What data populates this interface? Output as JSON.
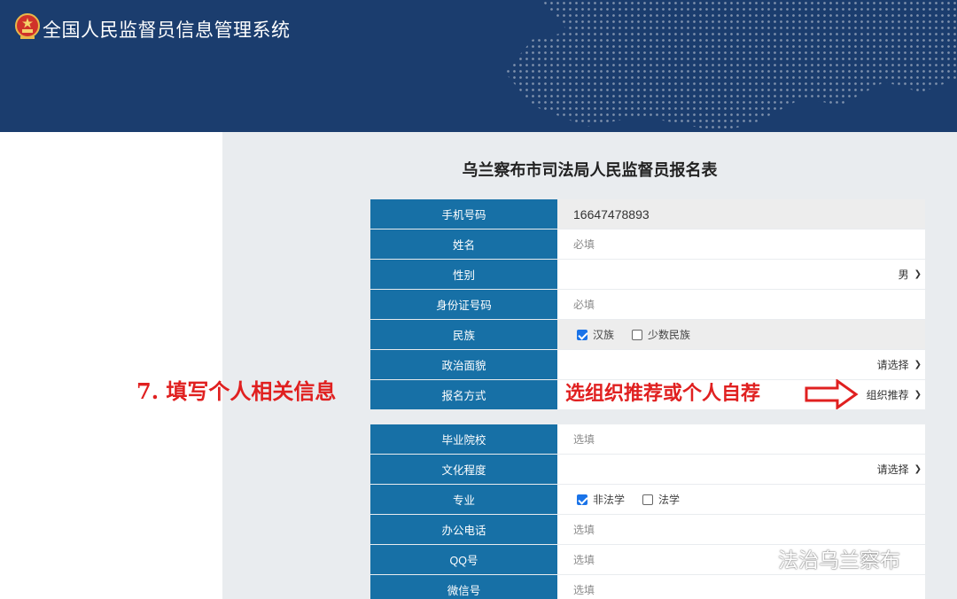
{
  "header": {
    "system_title": "全国人民监督员信息管理系统"
  },
  "form": {
    "title": "乌兰察布市司法局人民监督员报名表",
    "phone": {
      "label": "手机号码",
      "value": "16647478893"
    },
    "name": {
      "label": "姓名",
      "placeholder": "必填"
    },
    "gender": {
      "label": "性别",
      "selected": "男"
    },
    "id_number": {
      "label": "身份证号码",
      "placeholder": "必填"
    },
    "ethnicity": {
      "label": "民族",
      "options": [
        {
          "label": "汉族",
          "checked": true
        },
        {
          "label": "少数民族",
          "checked": false
        }
      ]
    },
    "political": {
      "label": "政治面貌",
      "selected": "请选择"
    },
    "apply_method": {
      "label": "报名方式",
      "selected": "组织推荐"
    },
    "school": {
      "label": "毕业院校",
      "placeholder": "选填"
    },
    "education": {
      "label": "文化程度",
      "selected": "请选择"
    },
    "major": {
      "label": "专业",
      "options": [
        {
          "label": "非法学",
          "checked": true
        },
        {
          "label": "法学",
          "checked": false
        }
      ]
    },
    "office_phone": {
      "label": "办公电话",
      "placeholder": "选填"
    },
    "qq": {
      "label": "QQ号",
      "placeholder": "选填"
    },
    "wechat": {
      "label": "微信号",
      "placeholder": "选填"
    }
  },
  "annotations": {
    "step": "7. 填写个人相关信息",
    "hint": "选组织推荐或个人自荐",
    "color": "#e02020"
  },
  "watermark": {
    "icon": "wechat-icon",
    "text": "法治乌兰察布"
  },
  "colors": {
    "header_bg": "#1b3d6e",
    "label_bg": "#1770a6",
    "panel_bg": "#e9ecef"
  }
}
